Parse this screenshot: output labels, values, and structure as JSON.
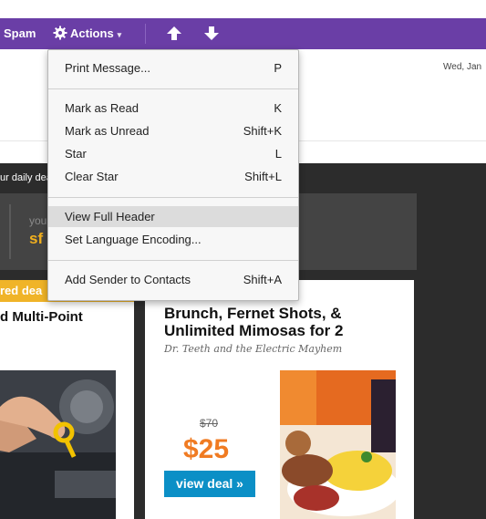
{
  "toolbar": {
    "spam_label": "Spam",
    "actions_label": "Actions",
    "actions_caret": "▾",
    "up_icon": "arrow-up-icon",
    "down_icon": "arrow-down-icon",
    "bar_color": "#6a3ea6"
  },
  "header": {
    "date": "Wed, Jan"
  },
  "actions_menu": {
    "items": [
      {
        "label": "Print Message...",
        "shortcut": "P"
      },
      {
        "label": "Mark as Read",
        "shortcut": "K"
      },
      {
        "label": "Mark as Unread",
        "shortcut": "Shift+K"
      },
      {
        "label": "Star",
        "shortcut": "L"
      },
      {
        "label": "Clear Star",
        "shortcut": "Shift+L"
      },
      {
        "label": "View Full Header",
        "shortcut": "",
        "highlighted": true
      },
      {
        "label": "Set Language Encoding...",
        "shortcut": ""
      },
      {
        "label": "Add Sender to Contacts",
        "shortcut": "Shift+A"
      }
    ]
  },
  "email": {
    "promo_text": "ur daily dea",
    "your_label": "you",
    "your_brand": "sf",
    "left_deal": {
      "badge": "red dea",
      "title": "d Multi-Point"
    },
    "right_deal": {
      "title": "Brunch, Fernet Shots, & Unlimited Mimosas for 2",
      "merchant": "Dr. Teeth and the Electric Mayhem",
      "old_price": "$70",
      "new_price": "$25",
      "cta": "view deal »"
    },
    "colors": {
      "background": "#2c2c2c",
      "badge": "#f0b428",
      "price": "#f07b22",
      "cta": "#0b8fc6"
    }
  }
}
